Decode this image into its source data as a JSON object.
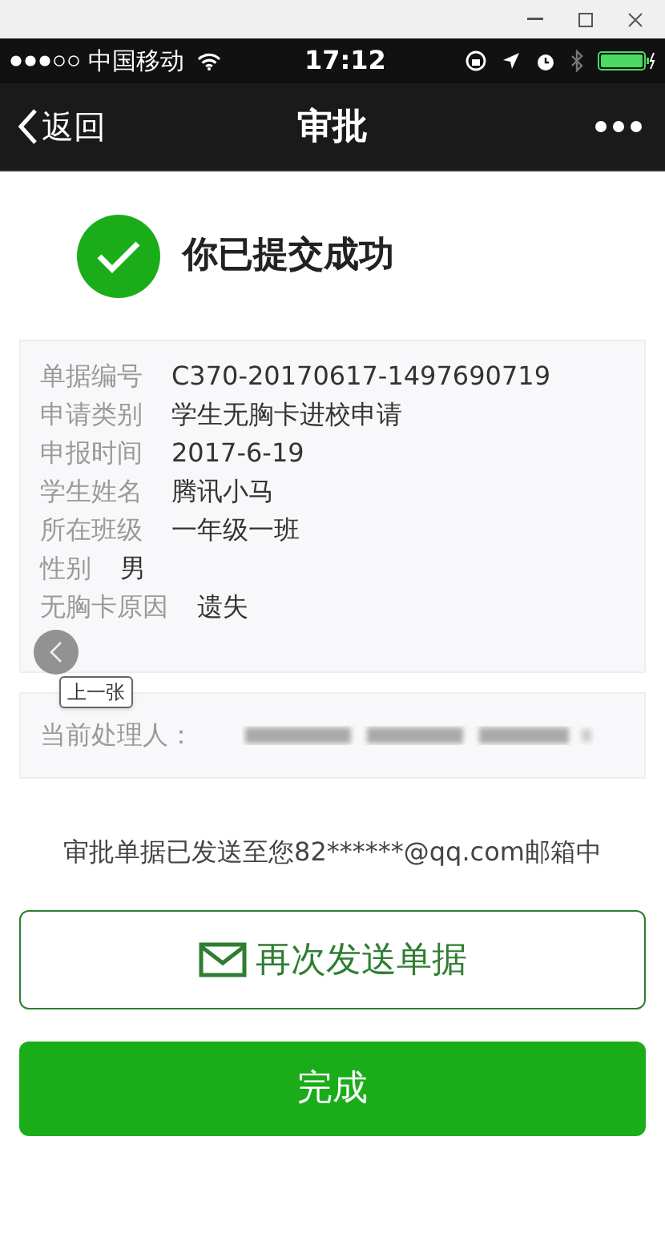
{
  "status_bar": {
    "carrier": "中国移动",
    "time": "17:12"
  },
  "nav_bar": {
    "back": "返回",
    "title": "审批"
  },
  "success": {
    "message": "你已提交成功"
  },
  "details": [
    {
      "label": "单据编号",
      "value": "C370-20170617-1497690719"
    },
    {
      "label": "申请类别",
      "value": "学生无胸卡进校申请"
    },
    {
      "label": "申报时间",
      "value": "2017-6-19"
    },
    {
      "label": "学生姓名",
      "value": "腾讯小马"
    },
    {
      "label": "所在班级",
      "value": "一年级一班"
    },
    {
      "label": "性别",
      "value": "男"
    },
    {
      "label": "无胸卡原因",
      "value": "遗失"
    }
  ],
  "viewer_overlay": {
    "tooltip": "上一张"
  },
  "handler": {
    "label": "当前处理人："
  },
  "email_notice": "审批单据已发送至您82******@qq.com邮箱中",
  "buttons": [
    {
      "kind": "outline",
      "label": "再次发送单据"
    },
    {
      "kind": "primary",
      "label": "完成"
    }
  ]
}
